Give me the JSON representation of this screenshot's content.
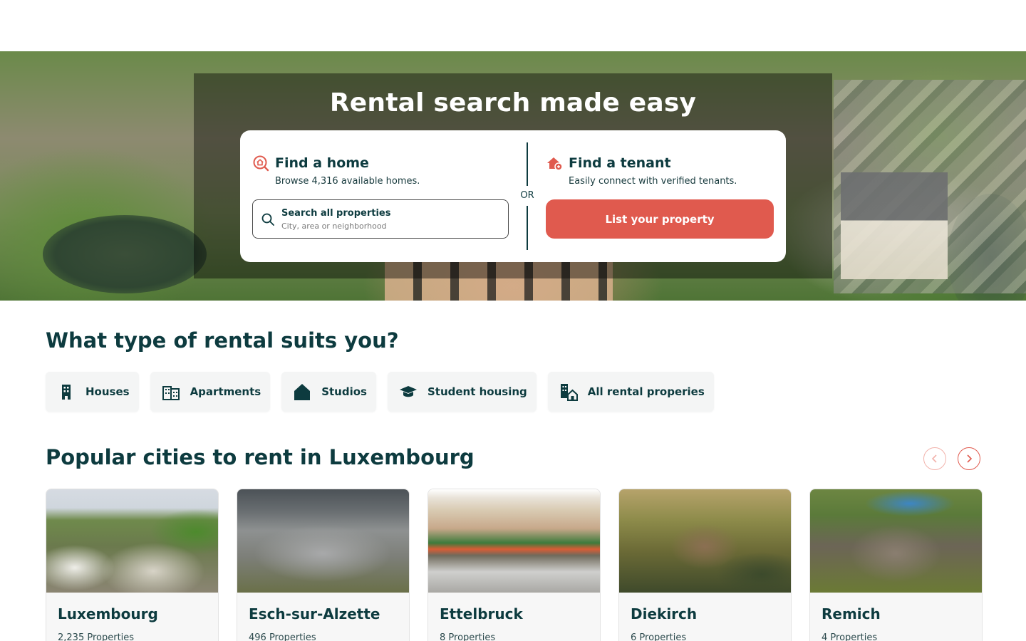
{
  "hero": {
    "title": "Rental search made easy",
    "find_home": {
      "title": "Find a home",
      "subtitle": "Browse 4,316 available homes.",
      "search_label": "Search all properties",
      "search_placeholder": "City, area or neighborhood"
    },
    "or_label": "OR",
    "find_tenant": {
      "title": "Find a tenant",
      "subtitle": "Easily connect with verified tenants.",
      "button_label": "List your property"
    }
  },
  "rental_types": {
    "title": "What type of rental suits you?",
    "items": [
      {
        "label": "Houses",
        "icon": "building-icon"
      },
      {
        "label": "Apartments",
        "icon": "apartment-icon"
      },
      {
        "label": "Studios",
        "icon": "house-icon"
      },
      {
        "label": "Student housing",
        "icon": "graduation-cap-icon"
      },
      {
        "label": "All rental properies",
        "icon": "buildings-home-icon"
      }
    ]
  },
  "cities": {
    "title": "Popular cities to rent in Luxembourg",
    "items": [
      {
        "name": "Luxembourg",
        "count": "2,235 Properties"
      },
      {
        "name": "Esch-sur-Alzette",
        "count": "496 Properties"
      },
      {
        "name": "Ettelbruck",
        "count": "8 Properties"
      },
      {
        "name": "Diekirch",
        "count": "6 Properties"
      },
      {
        "name": "Remich",
        "count": "4 Properties"
      }
    ]
  },
  "colors": {
    "primary_text": "#0d3b3f",
    "accent": "#e05a4e",
    "chip_bg": "#f4f5f5"
  }
}
